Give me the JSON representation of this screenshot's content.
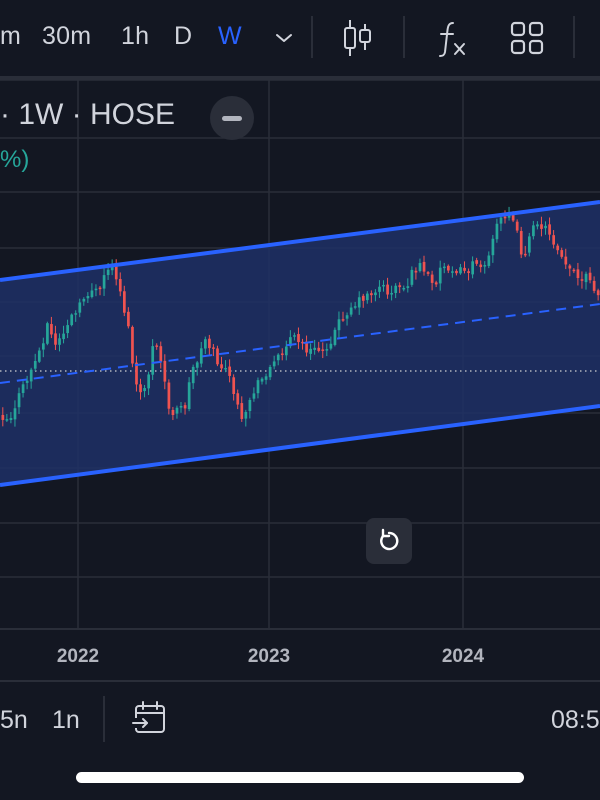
{
  "toolbar": {
    "timeframes": [
      {
        "label": "m",
        "active": false
      },
      {
        "label": "30m",
        "active": false
      },
      {
        "label": "1h",
        "active": false
      },
      {
        "label": "D",
        "active": false
      },
      {
        "label": "W",
        "active": true
      }
    ],
    "icons": [
      "chevron-down-icon",
      "candlestick-chart-icon",
      "function-fx-icon",
      "grid-layout-icon"
    ]
  },
  "legend": {
    "title": "· 1W · HOSE",
    "change": "%)"
  },
  "chart_data": {
    "type": "candlestick",
    "x_axis_labels": [
      "2022",
      "2023",
      "2024"
    ],
    "channel": {
      "upper_color": "#2962ff",
      "mid_line": "dashed",
      "fill": "#1e3066"
    },
    "up_color": "#26a69a",
    "down_color": "#ef5350",
    "grid": true,
    "price_line": "dotted"
  },
  "bottom_bar": {
    "ranges": [
      "5n",
      "1n"
    ],
    "clock": "08:5"
  },
  "colors": {
    "background": "#131722",
    "accent": "#2962ff",
    "up": "#26a69a",
    "down": "#ef5350",
    "text": "#d1d4dc",
    "grid": "#2a2e39"
  }
}
